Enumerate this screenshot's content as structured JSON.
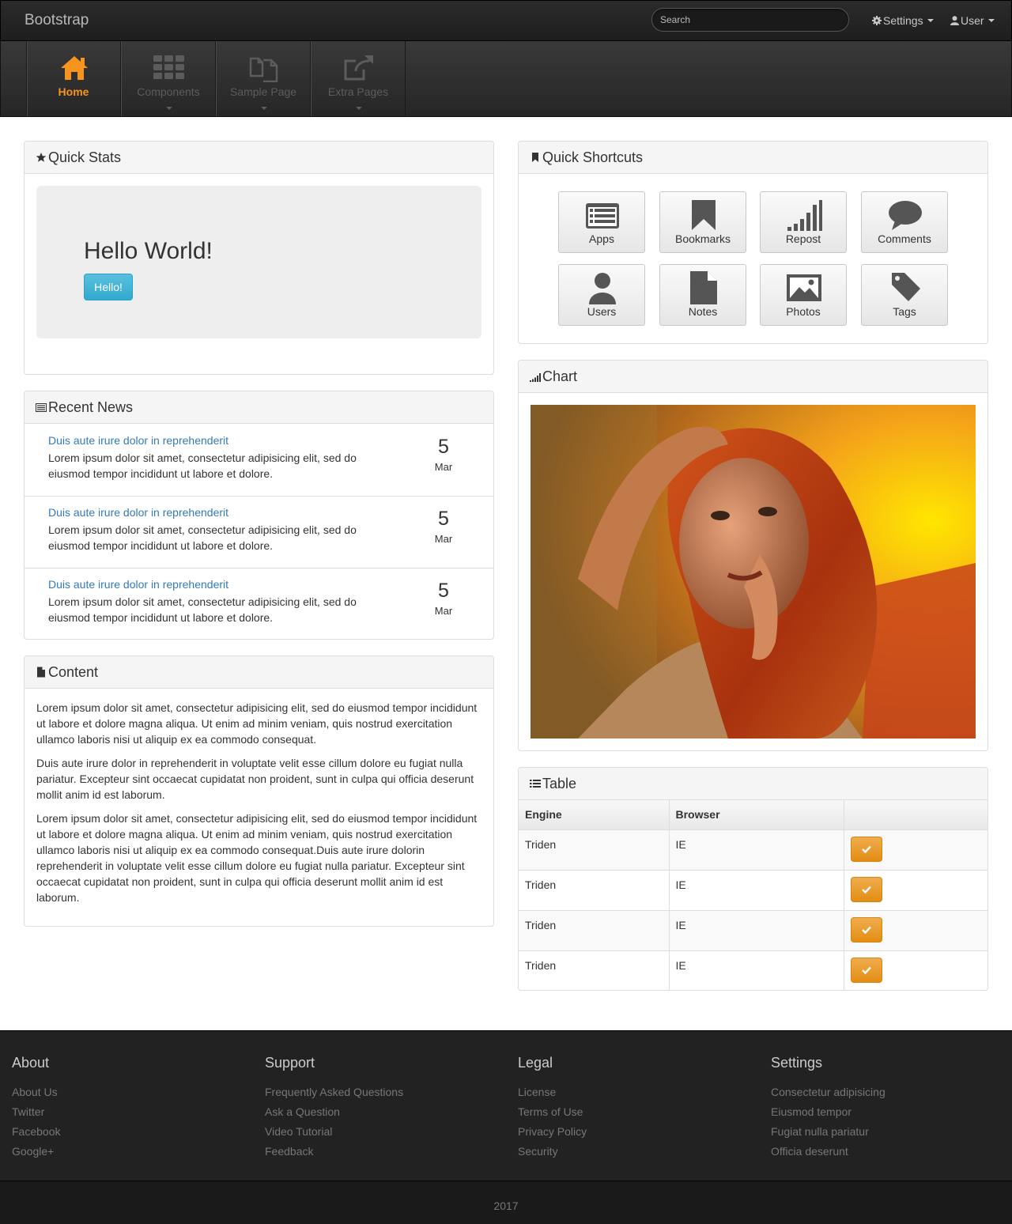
{
  "topbar": {
    "brand": "Bootstrap",
    "search_placeholder": "Search",
    "settings_label": "Settings",
    "user_label": "User"
  },
  "mainnav": [
    {
      "label": "Home",
      "icon": "home-icon",
      "active": true
    },
    {
      "label": "Components",
      "icon": "grid-icon"
    },
    {
      "label": "Sample Page",
      "icon": "files-icon"
    },
    {
      "label": "Extra Pages",
      "icon": "share-icon"
    }
  ],
  "quick_stats": {
    "title": "Quick Stats",
    "heading": "Hello World!",
    "button": "Hello!"
  },
  "recent_news": {
    "title": "Recent News",
    "items": [
      {
        "title": "Duis aute irure dolor in reprehenderit",
        "text": "Lorem ipsum dolor sit amet, consectetur adipisicing elit, sed do eiusmod tempor incididunt ut labore et dolore.",
        "day": "5",
        "month": "Mar"
      },
      {
        "title": "Duis aute irure dolor in reprehenderit",
        "text": "Lorem ipsum dolor sit amet, consectetur adipisicing elit, sed do eiusmod tempor incididunt ut labore et dolore.",
        "day": "5",
        "month": "Mar"
      },
      {
        "title": "Duis aute irure dolor in reprehenderit",
        "text": "Lorem ipsum dolor sit amet, consectetur adipisicing elit, sed do eiusmod tempor incididunt ut labore et dolore.",
        "day": "5",
        "month": "Mar"
      }
    ]
  },
  "content": {
    "title": "Content",
    "paragraphs": [
      "Lorem ipsum dolor sit amet, consectetur adipisicing elit, sed do eiusmod tempor incididunt ut labore et dolore magna aliqua. Ut enim ad minim veniam, quis nostrud exercitation ullamco laboris nisi ut aliquip ex ea commodo consequat.",
      "Duis aute irure dolor in reprehenderit in voluptate velit esse cillum dolore eu fugiat nulla pariatur. Excepteur sint occaecat cupidatat non proident, sunt in culpa qui officia deserunt mollit anim id est laborum.",
      "Lorem ipsum dolor sit amet, consectetur adipisicing elit, sed do eiusmod tempor incididunt ut labore et dolore magna aliqua. Ut enim ad minim veniam, quis nostrud exercitation ullamco laboris nisi ut aliquip ex ea commodo consequat.Duis aute irure dolorin reprehenderit in voluptate velit esse cillum dolore eu fugiat nulla pariatur. Excepteur sint occaecat cupidatat non proident, sunt in culpa qui officia deserunt mollit anim id est laborum."
    ]
  },
  "shortcuts": {
    "title": "Quick Shortcuts",
    "items": [
      {
        "label": "Apps",
        "icon": "list-icon"
      },
      {
        "label": "Bookmarks",
        "icon": "bookmark-icon"
      },
      {
        "label": "Repost",
        "icon": "signal-icon"
      },
      {
        "label": "Comments",
        "icon": "comment-icon"
      },
      {
        "label": "Users",
        "icon": "user-icon"
      },
      {
        "label": "Notes",
        "icon": "file-icon"
      },
      {
        "label": "Photos",
        "icon": "picture-icon"
      },
      {
        "label": "Tags",
        "icon": "tag-icon"
      }
    ]
  },
  "chart": {
    "title": "Chart"
  },
  "table": {
    "title": "Table",
    "headers": [
      "Engine",
      "Browser",
      ""
    ],
    "rows": [
      {
        "engine": "Triden",
        "browser": "IE"
      },
      {
        "engine": "Triden",
        "browser": "IE"
      },
      {
        "engine": "Triden",
        "browser": "IE"
      },
      {
        "engine": "Triden",
        "browser": "IE"
      }
    ]
  },
  "footer": {
    "columns": [
      {
        "title": "About",
        "links": [
          "About Us",
          "Twitter",
          "Facebook",
          "Google+"
        ]
      },
      {
        "title": "Support",
        "links": [
          "Frequently Asked Questions",
          "Ask a Question",
          "Video Tutorial",
          "Feedback"
        ]
      },
      {
        "title": "Legal",
        "links": [
          "License",
          "Terms of Use",
          "Privacy Policy",
          "Security"
        ]
      },
      {
        "title": "Settings",
        "links": [
          "Consectetur adipisicing",
          "Eiusmod tempor",
          "Fugiat nulla pariatur",
          "Officia deserunt"
        ]
      }
    ],
    "copyright": "2017"
  },
  "colors": {
    "accent": "#f7941d",
    "link": "#337ab7",
    "info_button": "#5bc0de",
    "warning_button": "#f0ad4e"
  }
}
